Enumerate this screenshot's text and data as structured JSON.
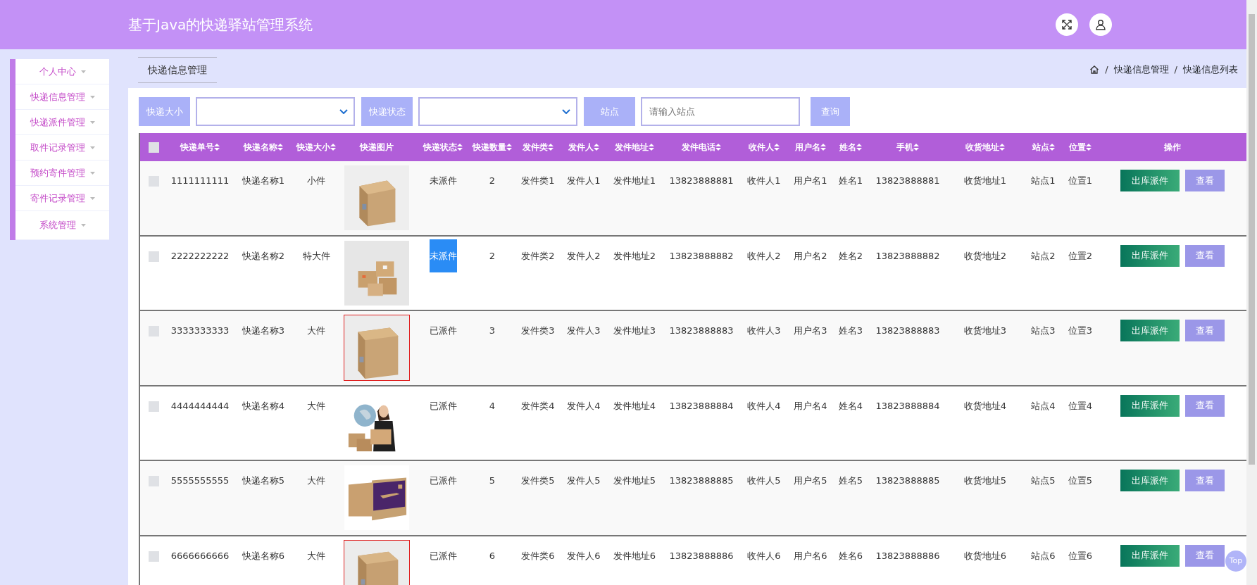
{
  "header": {
    "title": "基于Java的快递驿站管理系统"
  },
  "sidebar": {
    "items": [
      {
        "label": "个人中心"
      },
      {
        "label": "快递信息管理"
      },
      {
        "label": "快递派件管理"
      },
      {
        "label": "取件记录管理"
      },
      {
        "label": "预约寄件管理"
      },
      {
        "label": "寄件记录管理"
      },
      {
        "label": "系统管理"
      }
    ]
  },
  "page_tab": "快递信息管理",
  "breadcrumb": [
    {
      "separator": "/",
      "label": "快递信息管理"
    },
    {
      "separator": "/",
      "label": "快递信息列表"
    }
  ],
  "search": {
    "fields": [
      {
        "kind": "select",
        "label": "快递大小"
      },
      {
        "kind": "select",
        "label": "快递状态"
      },
      {
        "kind": "input",
        "label": "站点",
        "placeholder": "请输入站点"
      }
    ],
    "button": "查询"
  },
  "table": {
    "select_all_checked": false,
    "columns": [
      {
        "kind": "text",
        "label": "快递单号",
        "sortable": true
      },
      {
        "kind": "text",
        "label": "快递名称",
        "sortable": true
      },
      {
        "kind": "text",
        "label": "快递大小",
        "sortable": true
      },
      {
        "label": "快递图片",
        "sortable": false
      },
      {
        "kind": "status",
        "label": "快递状态",
        "sortable": true
      },
      {
        "kind": "text",
        "label": "快递数量",
        "sortable": true
      },
      {
        "kind": "text",
        "label": "发件类",
        "sortable": true
      },
      {
        "kind": "text",
        "label": "发件人",
        "sortable": true
      },
      {
        "kind": "text",
        "label": "发件地址",
        "sortable": true
      },
      {
        "kind": "text",
        "label": "发件电话",
        "sortable": true
      },
      {
        "kind": "text",
        "label": "收件人",
        "sortable": true
      },
      {
        "kind": "text",
        "label": "用户名",
        "sortable": true
      },
      {
        "kind": "text",
        "label": "姓名",
        "sortable": true
      },
      {
        "kind": "text",
        "label": "手机",
        "sortable": true
      },
      {
        "kind": "text",
        "label": "收货地址",
        "sortable": true
      },
      {
        "kind": "text",
        "label": "站点",
        "sortable": true
      },
      {
        "kind": "text",
        "label": "位置",
        "sortable": true
      },
      {
        "kind": "actions",
        "label": "操作",
        "sortable": false
      }
    ],
    "rows": [
      {
        "checked": false,
        "image_outlined": false,
        "status_highlighted": false,
        "cells": [
          "1111111111",
          "快递名称1",
          "小件",
          "",
          "未派件",
          "2",
          "发件类1",
          "发件人1",
          "发件地址1",
          "13823888881",
          "收件人1",
          "用户名1",
          "姓名1",
          "13823888881",
          "收货地址1",
          "站点1",
          "位置1"
        ],
        "actions": [
          "出库派件",
          "查看"
        ]
      },
      {
        "checked": false,
        "image_outlined": false,
        "status_highlighted": true,
        "cells": [
          "2222222222",
          "快递名称2",
          "特大件",
          "",
          "未派件",
          "2",
          "发件类2",
          "发件人2",
          "发件地址2",
          "13823888882",
          "收件人2",
          "用户名2",
          "姓名2",
          "13823888882",
          "收货地址2",
          "站点2",
          "位置2"
        ],
        "actions": [
          "出库派件",
          "查看"
        ]
      },
      {
        "checked": false,
        "image_outlined": true,
        "status_highlighted": false,
        "cells": [
          "3333333333",
          "快递名称3",
          "大件",
          "",
          "已派件",
          "3",
          "发件类3",
          "发件人3",
          "发件地址3",
          "13823888883",
          "收件人3",
          "用户名3",
          "姓名3",
          "13823888883",
          "收货地址3",
          "站点3",
          "位置3"
        ],
        "actions": [
          "出库派件",
          "查看"
        ]
      },
      {
        "checked": false,
        "image_outlined": false,
        "status_highlighted": false,
        "cells": [
          "4444444444",
          "快递名称4",
          "大件",
          "",
          "已派件",
          "4",
          "发件类4",
          "发件人4",
          "发件地址4",
          "13823888884",
          "收件人4",
          "用户名4",
          "姓名4",
          "13823888884",
          "收货地址4",
          "站点4",
          "位置4"
        ],
        "actions": [
          "出库派件",
          "查看"
        ]
      },
      {
        "checked": false,
        "image_outlined": false,
        "status_highlighted": false,
        "cells": [
          "5555555555",
          "快递名称5",
          "大件",
          "",
          "已派件",
          "5",
          "发件类5",
          "发件人5",
          "发件地址5",
          "13823888885",
          "收件人5",
          "用户名5",
          "姓名5",
          "13823888885",
          "收货地址5",
          "站点5",
          "位置5"
        ],
        "actions": [
          "出库派件",
          "查看"
        ]
      },
      {
        "checked": false,
        "image_outlined": true,
        "status_highlighted": false,
        "cells": [
          "6666666666",
          "快递名称6",
          "大件",
          "",
          "已派件",
          "6",
          "发件类6",
          "发件人6",
          "发件地址6",
          "13823888886",
          "收件人6",
          "用户名6",
          "姓名6",
          "13823888886",
          "收货地址6",
          "站点6",
          "位置6"
        ],
        "actions": [
          "出库派件",
          "查看"
        ]
      }
    ]
  },
  "back_to_top": "Top"
}
